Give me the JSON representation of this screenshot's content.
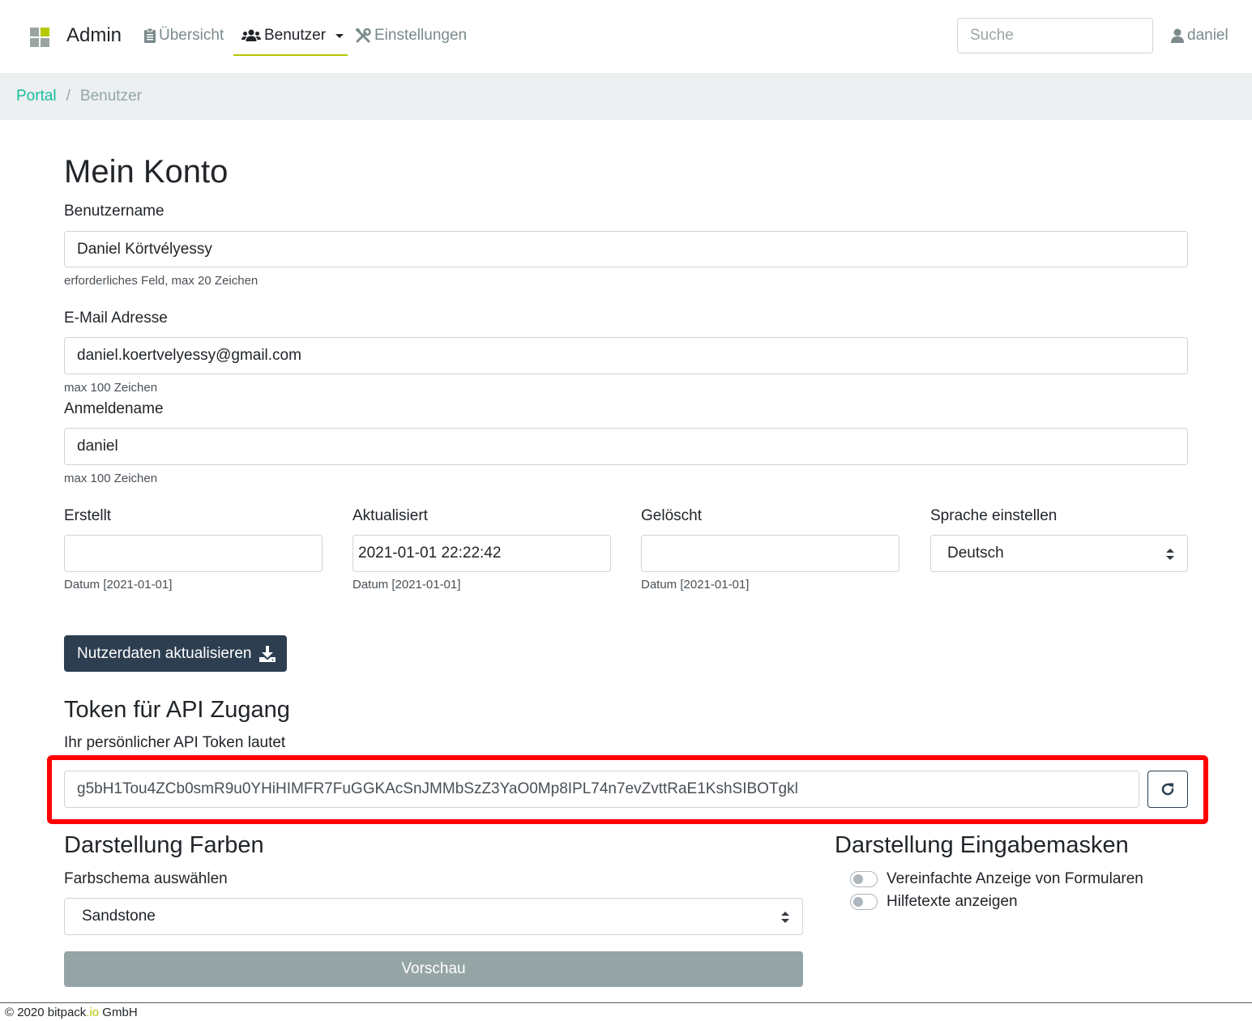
{
  "navbar": {
    "brand": "Admin",
    "items": [
      {
        "label": "Übersicht",
        "icon": "clipboard-icon"
      },
      {
        "label": "Benutzer",
        "icon": "users-icon",
        "active": true
      },
      {
        "label": "Einstellungen",
        "icon": "tools-icon"
      }
    ],
    "search_placeholder": "Suche",
    "user": "daniel"
  },
  "breadcrumb": {
    "items": [
      "Portal",
      "Benutzer"
    ],
    "separator": "/"
  },
  "page": {
    "title": "Mein Konto",
    "username": {
      "label": "Benutzername",
      "value": "Daniel Körtvélyessy",
      "help": "erforderliches Feld, max 20 Zeichen"
    },
    "email": {
      "label": "E-Mail Adresse",
      "value": "daniel.koertvelyessy@gmail.com",
      "help": "max 100 Zeichen"
    },
    "login": {
      "label": "Anmeldename",
      "value": "daniel",
      "help": "max 100 Zeichen"
    },
    "created": {
      "label": "Erstellt",
      "value": "",
      "help": "Datum [2021-01-01]"
    },
    "updated": {
      "label": "Aktualisiert",
      "value": "2021-01-01 22:22:42",
      "help": "Datum [2021-01-01]"
    },
    "deleted": {
      "label": "Gelöscht",
      "value": "",
      "help": "Datum [2021-01-01]"
    },
    "language": {
      "label": "Sprache einstellen",
      "value": "Deutsch"
    },
    "update_button": "Nutzerdaten aktualisieren"
  },
  "api_token": {
    "heading": "Token für API Zugang",
    "label": "Ihr persönlicher API Token lautet",
    "value": "g5bH1Tou4ZCb0smR9u0YHiHIMFR7FuGGKAcSnJMMbSzZ3YaO0Mp8IPL74n7evZvttRaE1KshSIBOTgkl"
  },
  "colors": {
    "heading": "Darstellung Farben",
    "label": "Farbschema auswählen",
    "value": "Sandstone",
    "preview_button": "Vorschau"
  },
  "forms": {
    "heading": "Darstellung Eingabemasken",
    "toggles": [
      {
        "label": "Vereinfachte Anzeige von Formularen",
        "checked": false
      },
      {
        "label": "Hilfetexte anzeigen",
        "checked": false
      }
    ]
  },
  "footer": {
    "prefix": "© 2020 bitpack",
    "suffix": ".io",
    "company": " GmbH"
  },
  "theme": {
    "accent": "#b5c800",
    "primary": "#2c3e50",
    "link": "#18bc9c",
    "highlight": "#ff0000"
  }
}
